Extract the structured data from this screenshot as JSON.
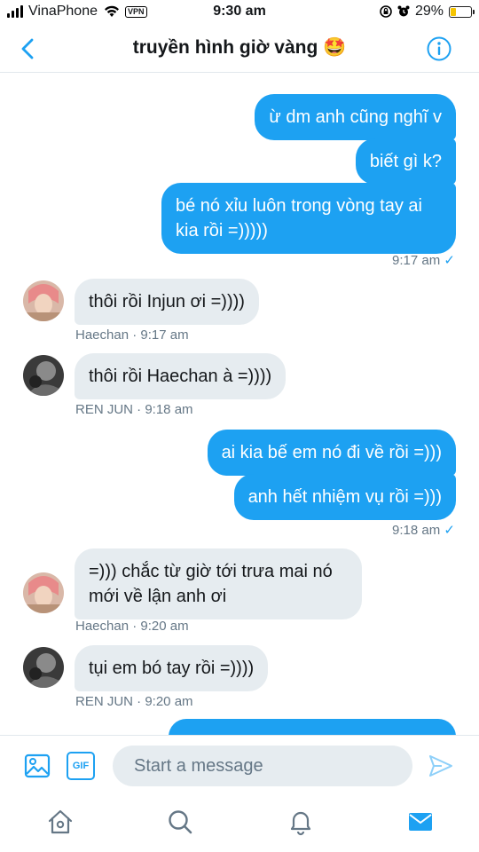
{
  "status_bar": {
    "carrier": "VinaPhone",
    "vpn": "VPN",
    "time": "9:30 am",
    "battery": "29%",
    "battery_level": 0.29
  },
  "header": {
    "title": "truyền hình giờ vàng 🤩"
  },
  "messages": {
    "m1": "ừ dm anh cũng nghĩ v",
    "m2": "biết gì k?",
    "m3": "bé nó xỉu luôn trong vòng tay ai kia rồi =)))))",
    "t1": "9:17 am",
    "m4": "thôi rồi Injun ơi =))))",
    "meta4": "Haechan · 9:17 am",
    "m5": "thôi rồi Haechan à =))))",
    "meta5": "REN JUN · 9:18 am",
    "m6": "ai kia bế em nó đi về rồi =)))",
    "m7": "anh hết nhiệm vụ rồi =)))",
    "t2": "9:18 am",
    "m8": "=))) chắc từ giờ tới trưa mai nó mới về lận anh ơi",
    "meta8": "Haechan · 9:20 am",
    "m9": "tụi em bó tay rồi =))))",
    "meta9": "REN JUN · 9:20 am"
  },
  "composer": {
    "gif_label": "GIF",
    "placeholder": "Start a message"
  },
  "icons": {
    "back": "chevron-left-icon",
    "info": "info-icon",
    "image": "image-icon",
    "gif": "gif-icon",
    "send": "send-icon",
    "home": "home-icon",
    "search": "search-icon",
    "notifications": "bell-icon",
    "messages": "mail-icon"
  },
  "colors": {
    "accent": "#1da1f2",
    "incoming_bubble": "#e6ecf0",
    "meta_text": "#657786"
  }
}
